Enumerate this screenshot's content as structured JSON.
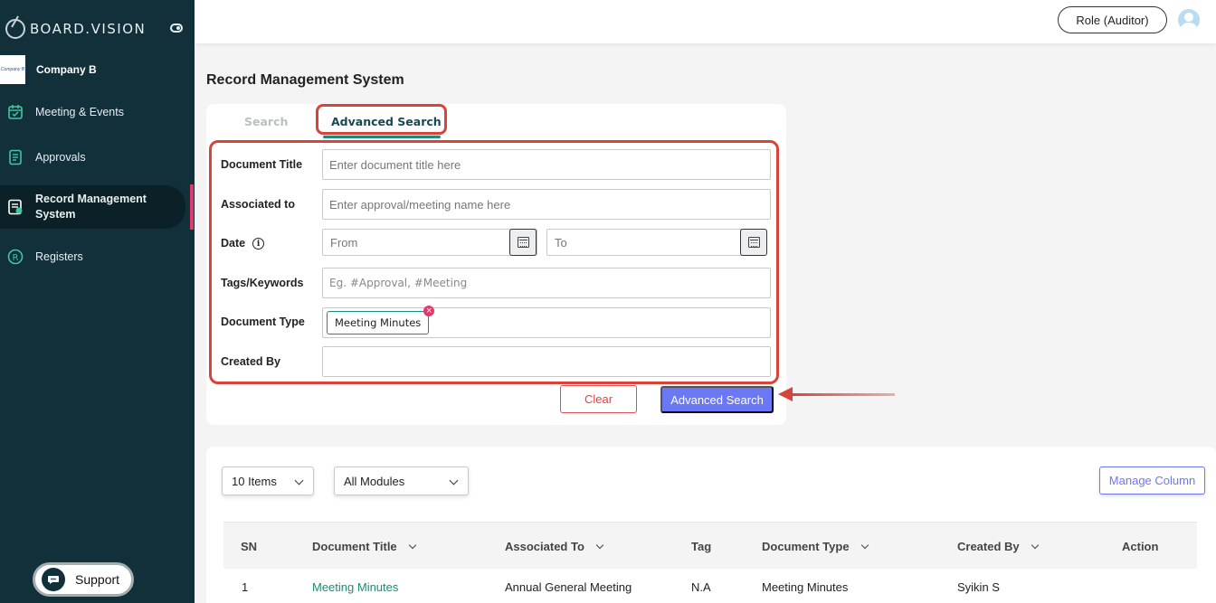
{
  "sidebar": {
    "brand": "BOARD.VISION",
    "company": {
      "logo_text": "Company B",
      "name": "Company B"
    },
    "items": [
      {
        "label": "Meeting & Events",
        "icon": "calendar-check-icon"
      },
      {
        "label": "Approvals",
        "icon": "document-list-icon"
      },
      {
        "label": "Record Management System",
        "icon": "record-icon",
        "active": true
      },
      {
        "label": "Registers",
        "icon": "registered-icon"
      }
    ],
    "support_label": "Support"
  },
  "header": {
    "role_label": "Role (Auditor)"
  },
  "page": {
    "title": "Record Management System"
  },
  "tabs": [
    {
      "label": "Search",
      "active": false
    },
    {
      "label": "Advanced Search",
      "active": true
    }
  ],
  "form": {
    "document_title": {
      "label": "Document Title",
      "placeholder": "Enter document title here"
    },
    "associated_to": {
      "label": "Associated to",
      "placeholder": "Enter approval/meeting name here"
    },
    "date": {
      "label": "Date",
      "from_placeholder": "From",
      "to_placeholder": "To"
    },
    "tags": {
      "label": "Tags/Keywords",
      "placeholder": "Eg. #Approval, #Meeting"
    },
    "document_type": {
      "label": "Document Type",
      "chip": "Meeting Minutes"
    },
    "created_by": {
      "label": "Created By",
      "value": ""
    },
    "clear_label": "Clear",
    "submit_label": "Advanced Search"
  },
  "results": {
    "items_select": "10 Items",
    "module_select": "All Modules",
    "manage_column_label": "Manage Column",
    "columns": [
      "SN",
      "Document Title",
      "Associated To",
      "Tag",
      "Document Type",
      "Created By",
      "Action"
    ],
    "rows": [
      {
        "sn": "1",
        "title": "Meeting Minutes",
        "associated": "Annual General Meeting",
        "tag": "N.A",
        "type": "Meeting Minutes",
        "created_by": "Syikin S",
        "action": ""
      }
    ]
  },
  "colors": {
    "sidebar": "#12303a",
    "accent": "#1b8c7a",
    "primary_button": "#6b78f5",
    "highlight": "#d8443a",
    "active_bar": "#e2386a"
  }
}
